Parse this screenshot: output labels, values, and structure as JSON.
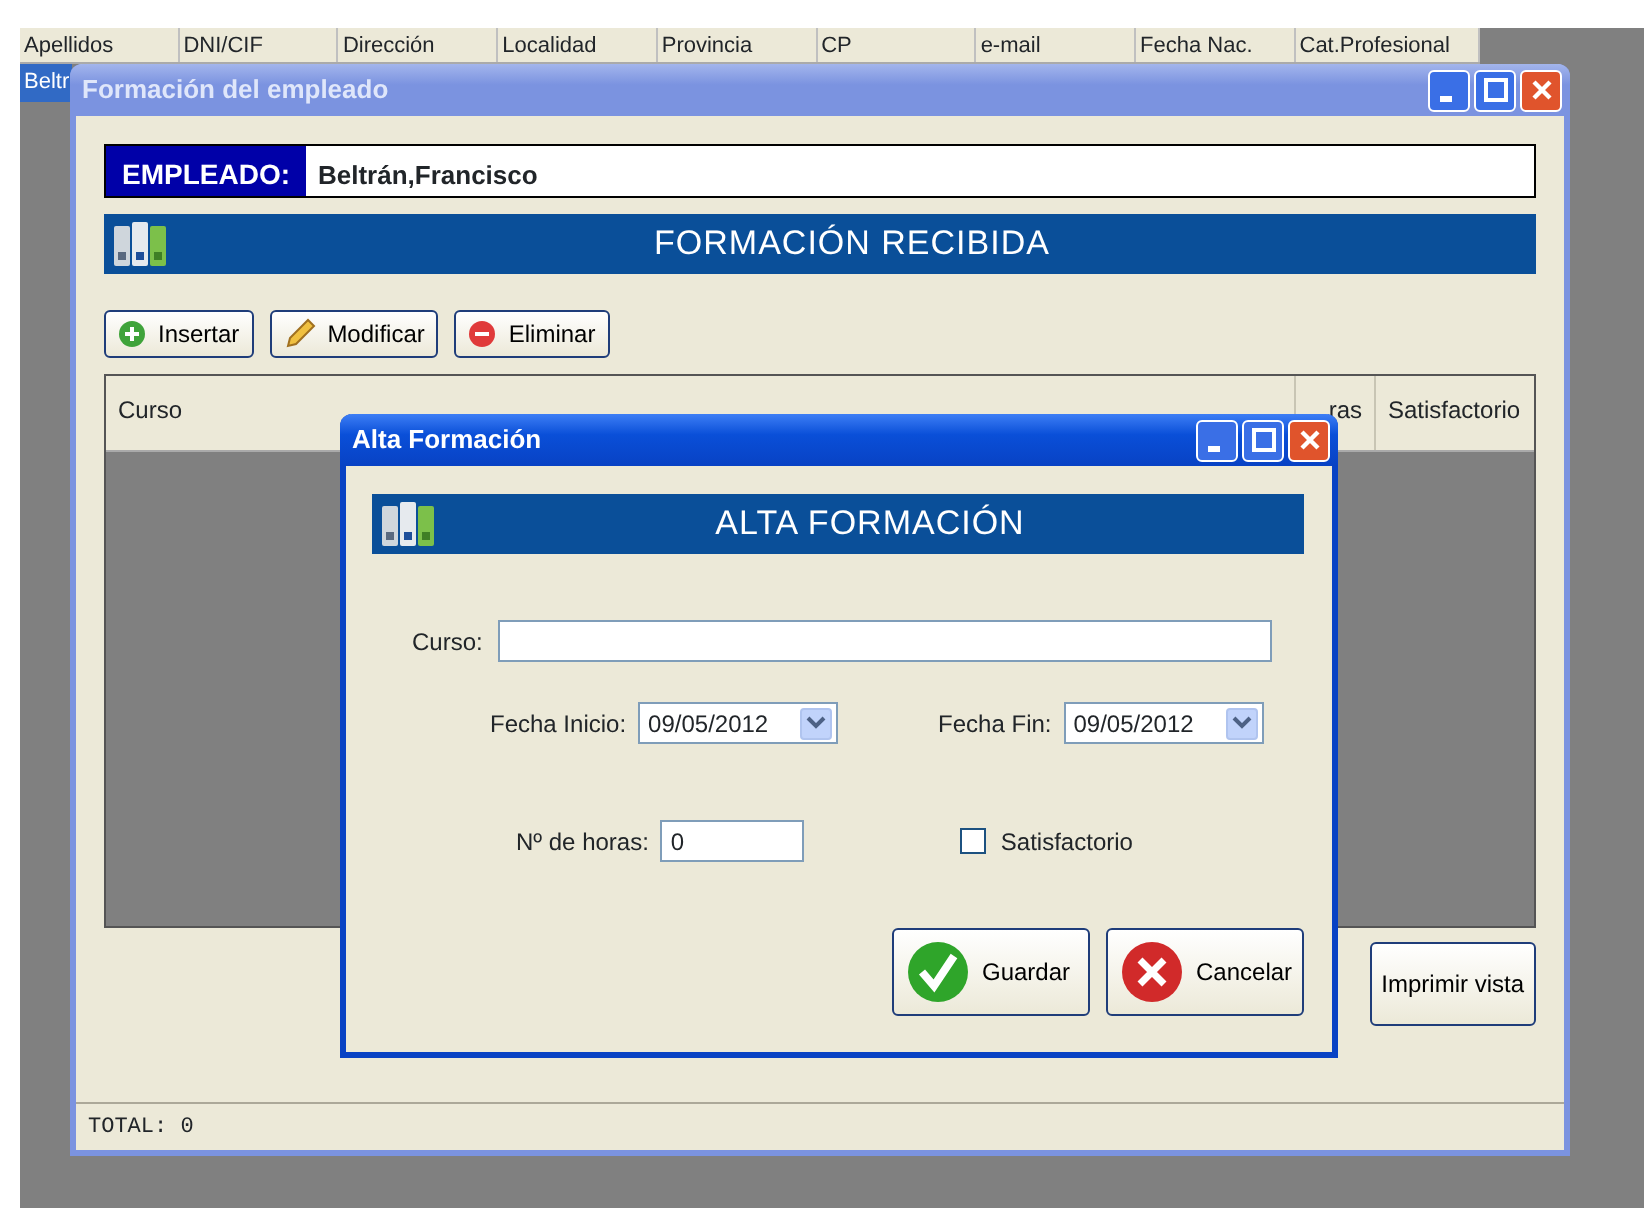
{
  "background_table": {
    "columns": [
      "Apellidos",
      "DNI/CIF",
      "Dirección",
      "Localidad",
      "Provincia",
      "CP",
      "e-mail",
      "Fecha Nac.",
      "Cat.Profesional"
    ],
    "row_cell": "Beltr"
  },
  "window": {
    "title": "Formación del empleado"
  },
  "employee": {
    "label": "EMPLEADO:",
    "value": "Beltrán,Francisco"
  },
  "banner": {
    "title": "FORMACIÓN RECIBIDA"
  },
  "toolbar": [
    {
      "label": "Insertar",
      "kind": "add"
    },
    {
      "label": "Modificar",
      "kind": "edit"
    },
    {
      "label": "Eliminar",
      "kind": "delete"
    }
  ],
  "grid": {
    "columns": [
      "Curso",
      "ras",
      "Satisfactorio"
    ]
  },
  "print_button": {
    "label": "Imprimir vista"
  },
  "status_bar": "TOTAL: 0",
  "dialog": {
    "title": "Alta Formación",
    "banner": "ALTA FORMACIÓN",
    "curso": {
      "label": "Curso:"
    },
    "fecha_inicio": {
      "label": "Fecha Inicio:",
      "value": "09/05/2012"
    },
    "fecha_fin": {
      "label": "Fecha Fin:",
      "value": "09/05/2012"
    },
    "horas": {
      "label": "Nº de horas:",
      "value": "0"
    },
    "satisfactorio": {
      "label": "Satisfactorio",
      "checked": false
    },
    "buttons": [
      {
        "label": "Guardar",
        "kind": "ok"
      },
      {
        "label": "Cancelar",
        "kind": "cancel"
      }
    ]
  }
}
